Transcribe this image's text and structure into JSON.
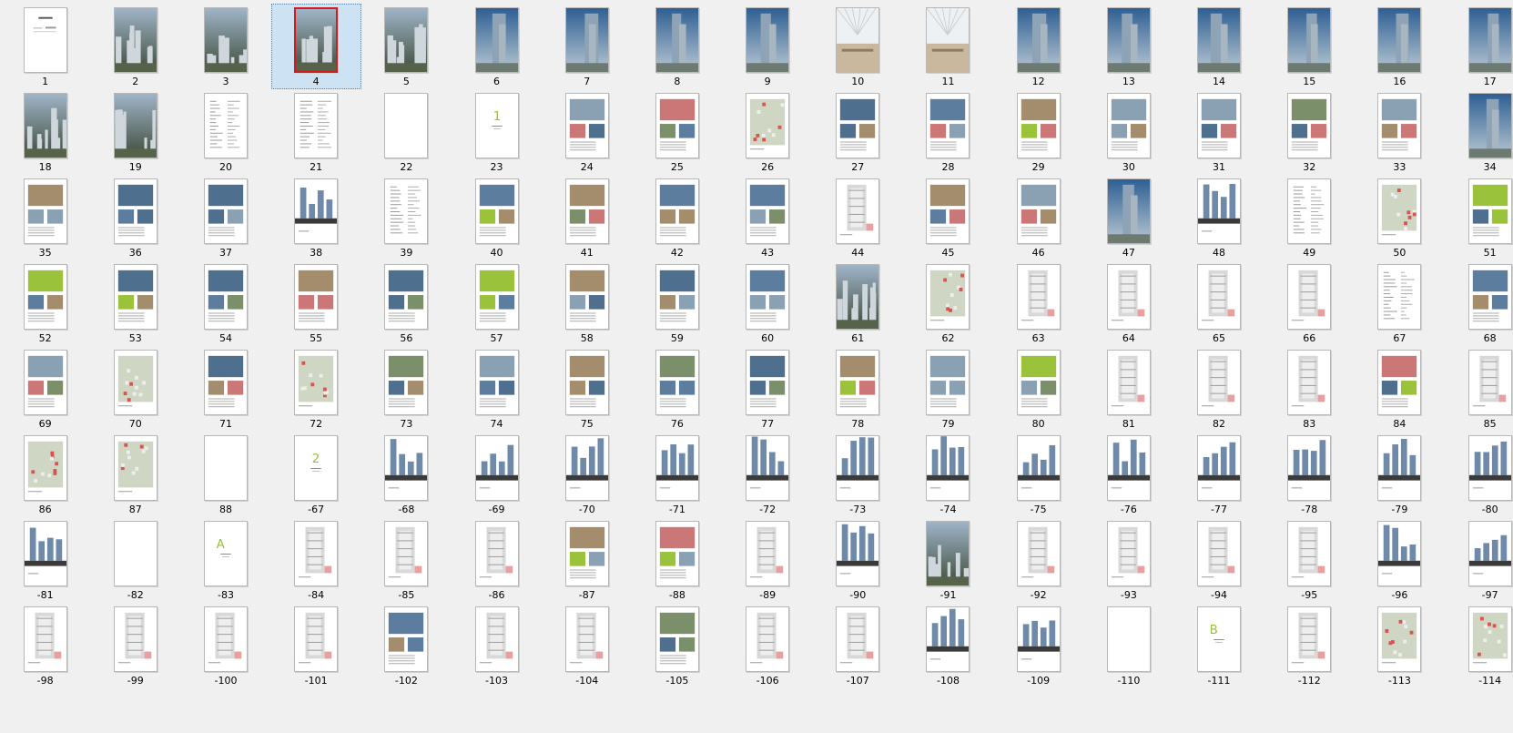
{
  "selected_index": 3,
  "styles": {
    "blank": {
      "bg": "#ffffff"
    },
    "title": {
      "bg": "#ffffff"
    },
    "photo": {
      "bg": "#7d92a6"
    },
    "tower": {
      "bg": "#4c6c8c"
    },
    "atrium": {
      "bg": "#e4e8ec"
    },
    "doc": {
      "bg": "#ffffff"
    },
    "elev": {
      "bg": "#ffffff"
    },
    "plan": {
      "bg": "#ffffff"
    },
    "mixed": {
      "bg": "#ffffff"
    },
    "site": {
      "bg": "#ffffff"
    },
    "chapter": {
      "bg": "#ffffff"
    }
  },
  "pages": [
    {
      "label": "1",
      "style": "title"
    },
    {
      "label": "2",
      "style": "photo"
    },
    {
      "label": "3",
      "style": "photo"
    },
    {
      "label": "4",
      "style": "photo"
    },
    {
      "label": "5",
      "style": "photo"
    },
    {
      "label": "6",
      "style": "tower"
    },
    {
      "label": "7",
      "style": "tower"
    },
    {
      "label": "8",
      "style": "tower"
    },
    {
      "label": "9",
      "style": "tower"
    },
    {
      "label": "10",
      "style": "atrium"
    },
    {
      "label": "11",
      "style": "atrium"
    },
    {
      "label": "12",
      "style": "tower"
    },
    {
      "label": "13",
      "style": "tower"
    },
    {
      "label": "14",
      "style": "tower"
    },
    {
      "label": "15",
      "style": "tower"
    },
    {
      "label": "16",
      "style": "tower"
    },
    {
      "label": "17",
      "style": "tower"
    },
    {
      "label": "18",
      "style": "photo"
    },
    {
      "label": "19",
      "style": "photo"
    },
    {
      "label": "20",
      "style": "doc"
    },
    {
      "label": "21",
      "style": "doc"
    },
    {
      "label": "22",
      "style": "blank"
    },
    {
      "label": "23",
      "style": "chapter",
      "glyph": "1"
    },
    {
      "label": "24",
      "style": "mixed"
    },
    {
      "label": "25",
      "style": "mixed"
    },
    {
      "label": "26",
      "style": "site"
    },
    {
      "label": "27",
      "style": "mixed"
    },
    {
      "label": "28",
      "style": "mixed"
    },
    {
      "label": "29",
      "style": "mixed"
    },
    {
      "label": "30",
      "style": "mixed"
    },
    {
      "label": "31",
      "style": "mixed"
    },
    {
      "label": "32",
      "style": "mixed"
    },
    {
      "label": "33",
      "style": "mixed"
    },
    {
      "label": "34",
      "style": "tower"
    },
    {
      "label": "35",
      "style": "mixed"
    },
    {
      "label": "36",
      "style": "mixed"
    },
    {
      "label": "37",
      "style": "mixed"
    },
    {
      "label": "38",
      "style": "elev"
    },
    {
      "label": "39",
      "style": "doc"
    },
    {
      "label": "40",
      "style": "mixed"
    },
    {
      "label": "41",
      "style": "mixed"
    },
    {
      "label": "42",
      "style": "mixed"
    },
    {
      "label": "43",
      "style": "mixed"
    },
    {
      "label": "44",
      "style": "plan"
    },
    {
      "label": "45",
      "style": "mixed"
    },
    {
      "label": "46",
      "style": "mixed"
    },
    {
      "label": "47",
      "style": "tower"
    },
    {
      "label": "48",
      "style": "elev"
    },
    {
      "label": "49",
      "style": "doc"
    },
    {
      "label": "50",
      "style": "site"
    },
    {
      "label": "51",
      "style": "mixed"
    },
    {
      "label": "52",
      "style": "mixed"
    },
    {
      "label": "53",
      "style": "mixed"
    },
    {
      "label": "54",
      "style": "mixed"
    },
    {
      "label": "55",
      "style": "mixed"
    },
    {
      "label": "56",
      "style": "mixed"
    },
    {
      "label": "57",
      "style": "mixed"
    },
    {
      "label": "58",
      "style": "mixed"
    },
    {
      "label": "59",
      "style": "mixed"
    },
    {
      "label": "60",
      "style": "mixed"
    },
    {
      "label": "61",
      "style": "photo"
    },
    {
      "label": "62",
      "style": "site"
    },
    {
      "label": "63",
      "style": "plan"
    },
    {
      "label": "64",
      "style": "plan"
    },
    {
      "label": "65",
      "style": "plan"
    },
    {
      "label": "66",
      "style": "plan"
    },
    {
      "label": "67",
      "style": "doc"
    },
    {
      "label": "68",
      "style": "mixed"
    },
    {
      "label": "69",
      "style": "mixed"
    },
    {
      "label": "70",
      "style": "site"
    },
    {
      "label": "71",
      "style": "mixed"
    },
    {
      "label": "72",
      "style": "site"
    },
    {
      "label": "73",
      "style": "mixed"
    },
    {
      "label": "74",
      "style": "mixed"
    },
    {
      "label": "75",
      "style": "mixed"
    },
    {
      "label": "76",
      "style": "mixed"
    },
    {
      "label": "77",
      "style": "mixed"
    },
    {
      "label": "78",
      "style": "mixed"
    },
    {
      "label": "79",
      "style": "mixed"
    },
    {
      "label": "80",
      "style": "mixed"
    },
    {
      "label": "81",
      "style": "plan"
    },
    {
      "label": "82",
      "style": "plan"
    },
    {
      "label": "83",
      "style": "plan"
    },
    {
      "label": "84",
      "style": "mixed"
    },
    {
      "label": "85",
      "style": "plan"
    },
    {
      "label": "86",
      "style": "site"
    },
    {
      "label": "87",
      "style": "site"
    },
    {
      "label": "88",
      "style": "blank"
    },
    {
      "label": "-67",
      "style": "chapter",
      "glyph": "2"
    },
    {
      "label": "-68",
      "style": "elev"
    },
    {
      "label": "-69",
      "style": "elev"
    },
    {
      "label": "-70",
      "style": "elev"
    },
    {
      "label": "-71",
      "style": "elev"
    },
    {
      "label": "-72",
      "style": "elev"
    },
    {
      "label": "-73",
      "style": "elev"
    },
    {
      "label": "-74",
      "style": "elev"
    },
    {
      "label": "-75",
      "style": "elev"
    },
    {
      "label": "-76",
      "style": "elev"
    },
    {
      "label": "-77",
      "style": "elev"
    },
    {
      "label": "-78",
      "style": "elev"
    },
    {
      "label": "-79",
      "style": "elev"
    },
    {
      "label": "-80",
      "style": "elev"
    },
    {
      "label": "-81",
      "style": "elev"
    },
    {
      "label": "-82",
      "style": "blank"
    },
    {
      "label": "-83",
      "style": "chapter",
      "glyph": "A"
    },
    {
      "label": "-84",
      "style": "plan"
    },
    {
      "label": "-85",
      "style": "plan"
    },
    {
      "label": "-86",
      "style": "plan"
    },
    {
      "label": "-87",
      "style": "mixed"
    },
    {
      "label": "-88",
      "style": "mixed"
    },
    {
      "label": "-89",
      "style": "plan"
    },
    {
      "label": "-90",
      "style": "elev"
    },
    {
      "label": "-91",
      "style": "photo"
    },
    {
      "label": "-92",
      "style": "plan"
    },
    {
      "label": "-93",
      "style": "plan"
    },
    {
      "label": "-94",
      "style": "plan"
    },
    {
      "label": "-95",
      "style": "plan"
    },
    {
      "label": "-96",
      "style": "elev"
    },
    {
      "label": "-97",
      "style": "elev"
    },
    {
      "label": "-98",
      "style": "plan"
    },
    {
      "label": "-99",
      "style": "plan"
    },
    {
      "label": "-100",
      "style": "plan"
    },
    {
      "label": "-101",
      "style": "plan"
    },
    {
      "label": "-102",
      "style": "mixed"
    },
    {
      "label": "-103",
      "style": "plan"
    },
    {
      "label": "-104",
      "style": "plan"
    },
    {
      "label": "-105",
      "style": "mixed"
    },
    {
      "label": "-106",
      "style": "plan"
    },
    {
      "label": "-107",
      "style": "plan"
    },
    {
      "label": "-108",
      "style": "elev"
    },
    {
      "label": "-109",
      "style": "elev"
    },
    {
      "label": "-110",
      "style": "blank"
    },
    {
      "label": "-111",
      "style": "chapter",
      "glyph": "B"
    },
    {
      "label": "-112",
      "style": "plan"
    },
    {
      "label": "-113",
      "style": "site"
    },
    {
      "label": "-114",
      "style": "site"
    }
  ]
}
